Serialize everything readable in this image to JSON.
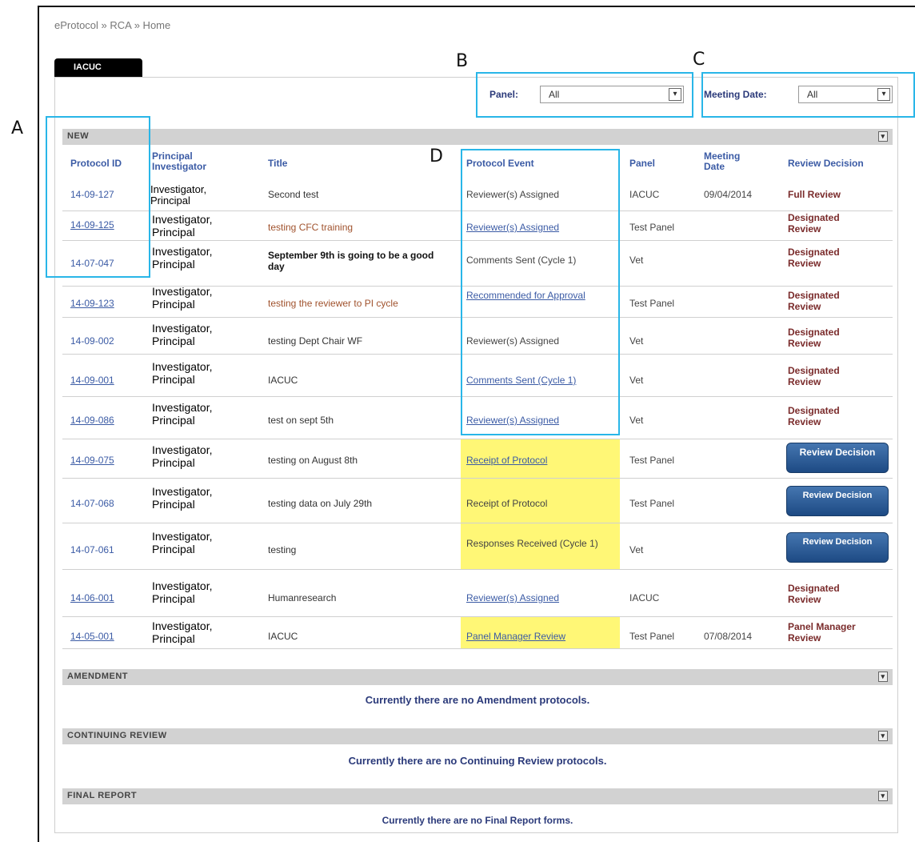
{
  "annotations": {
    "a": "A",
    "b": "B",
    "c": "C",
    "d": "D"
  },
  "breadcrumb": "eProtocol » RCA » Home",
  "tab": {
    "label": "IACUC"
  },
  "filters": {
    "panel_label": "Panel:",
    "panel_value": "All",
    "meeting_label": "Meeting Date:",
    "meeting_value": "All"
  },
  "sections": {
    "new": "NEW",
    "amendment": "AMENDMENT",
    "continuing": "CONTINUING REVIEW",
    "final": "FINAL REPORT"
  },
  "columns": {
    "protocol_id": "Protocol ID",
    "pi": "Principal Investigator",
    "title": "Title",
    "event": "Protocol Event",
    "panel": "Panel",
    "meeting": "Meeting Date",
    "decision": "Review Decision"
  },
  "rows": [
    {
      "id": "14-09-127",
      "pi": "Investigator, Principal",
      "title": "Second test",
      "event": "Reviewer(s) Assigned",
      "panel": "IACUC",
      "date": "09/04/2014",
      "decision": "Full Review"
    },
    {
      "id": "14-09-125",
      "pi": "Investigator, Principal",
      "title": "testing CFC training",
      "event": "Reviewer(s) Assigned",
      "panel": "Test Panel",
      "date": "",
      "decision": "Designated Review"
    },
    {
      "id": "14-07-047",
      "pi": "Investigator, Principal",
      "title": "September 9th is going to be a good day",
      "event": "Comments Sent (Cycle 1)",
      "panel": "Vet",
      "date": "",
      "decision": "Designated Review"
    },
    {
      "id": "14-09-123",
      "pi": "Investigator, Principal",
      "title": "testing the reviewer to PI cycle",
      "event": "Recommended for Approval",
      "panel": "Test Panel",
      "date": "",
      "decision": "Designated Review"
    },
    {
      "id": "14-09-002",
      "pi": "Investigator, Principal",
      "title": "testing Dept Chair WF",
      "event": "Reviewer(s) Assigned",
      "panel": "Vet",
      "date": "",
      "decision": "Designated Review"
    },
    {
      "id": "14-09-001",
      "pi": "Investigator, Principal",
      "title": "IACUC",
      "event": "Comments Sent (Cycle 1)",
      "panel": "Vet",
      "date": "",
      "decision": "Designated Review"
    },
    {
      "id": "14-09-086",
      "pi": "Investigator, Principal",
      "title": "test on sept 5th",
      "event": "Reviewer(s) Assigned",
      "panel": "Vet",
      "date": "",
      "decision": "Designated Review"
    },
    {
      "id": "14-09-075",
      "pi": "Investigator, Principal",
      "title": "testing on August 8th",
      "event": "Receipt of Protocol",
      "panel": "Test Panel",
      "date": "",
      "decision": "Review Decision"
    },
    {
      "id": "14-07-068",
      "pi": "Investigator, Principal",
      "title": "testing data on July 29th",
      "event": "Receipt of Protocol",
      "panel": "Test Panel",
      "date": "",
      "decision": "Review Decision"
    },
    {
      "id": "14-07-061",
      "pi": "Investigator, Principal",
      "title": "testing",
      "event": "Responses Received (Cycle 1)",
      "panel": "Vet",
      "date": "",
      "decision": "Review Decision"
    },
    {
      "id": "14-06-001",
      "pi": "Investigator, Principal",
      "title": "Humanresearch",
      "event": "Reviewer(s) Assigned",
      "panel": "IACUC",
      "date": "",
      "decision": "Designated Review"
    },
    {
      "id": "14-05-001",
      "pi": "Investigator, Principal",
      "title": "IACUC",
      "event": "Panel Manager Review",
      "panel": "Test Panel",
      "date": "07/08/2014",
      "decision": "Panel Manager Review"
    }
  ],
  "messages": {
    "amendment": "Currently there are no Amendment protocols.",
    "continuing": "Currently there are no Continuing Review protocols.",
    "final": "Currently there are no Final Report forms."
  },
  "icons": {
    "toggle": "collapse-icon",
    "dropdown": "chevron-down-icon"
  }
}
